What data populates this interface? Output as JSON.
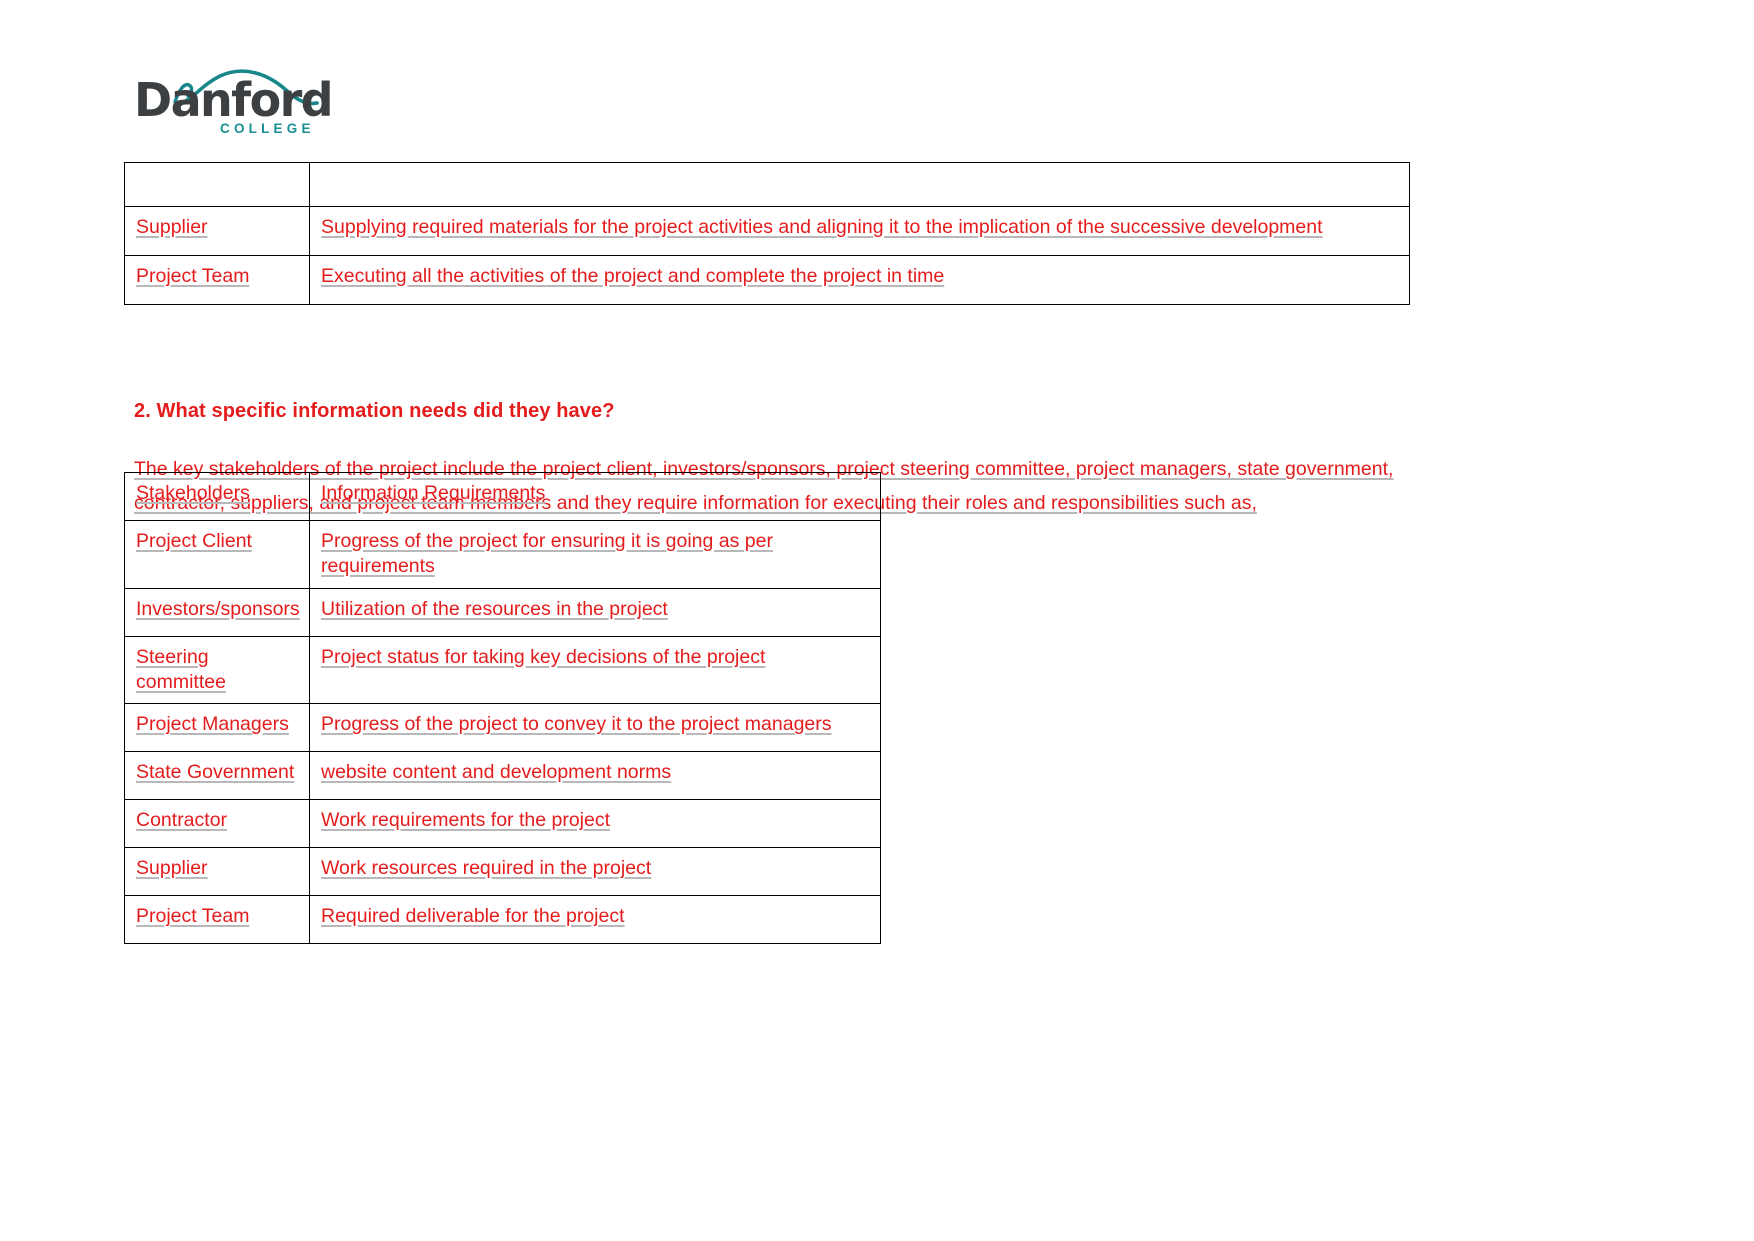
{
  "logo": {
    "wordmark": "Danford",
    "subtitle": "COLLEGE",
    "wordmark_color": "#3c4043",
    "accent_color": "#1a8f94"
  },
  "theme": {
    "text_red": "#e51c1c",
    "spellcheck_underline": "#b8b8b8",
    "table_border": "#000000"
  },
  "roles_table": {
    "rows": [
      {
        "stakeholder": "",
        "description": ""
      },
      {
        "stakeholder": "Supplier",
        "description": "Supplying required materials for the project activities and aligning it to the implication of the successive development"
      },
      {
        "stakeholder": "Project Team",
        "description": "Executing all the activities of the project and complete the project in time"
      }
    ]
  },
  "question": {
    "heading": "2. What specific information needs did they have?",
    "paragraph_line_1": "The key stakeholders of the project include the project client, investors/sponsors, project steering committee, project managers, state government,",
    "paragraph_line_2": "contractor, suppliers, and project team members and they require information for executing their roles and responsibilities such as,"
  },
  "info_table": {
    "header": {
      "stakeholders": "Stakeholders",
      "information_requirements": "Information Requirements"
    },
    "rows": [
      {
        "stakeholder": "Project Client",
        "requirement": "Progress of the project for ensuring it is going as per requirements"
      },
      {
        "stakeholder": "Investors/sponsors",
        "requirement": "Utilization of the resources in the project "
      },
      {
        "stakeholder": "Steering committee",
        "requirement": "Project status for taking key decisions of the project "
      },
      {
        "stakeholder": "Project Managers",
        "requirement": "Progress of the project to convey it to the project managers"
      },
      {
        "stakeholder": "State Government",
        "requirement": "website content and development norms"
      },
      {
        "stakeholder": "Contractor",
        "requirement": "Work requirements for the project"
      },
      {
        "stakeholder": "Supplier",
        "requirement": "Work resources required in the project "
      },
      {
        "stakeholder": "Project Team",
        "requirement": "Required deliverable for the project "
      }
    ]
  }
}
